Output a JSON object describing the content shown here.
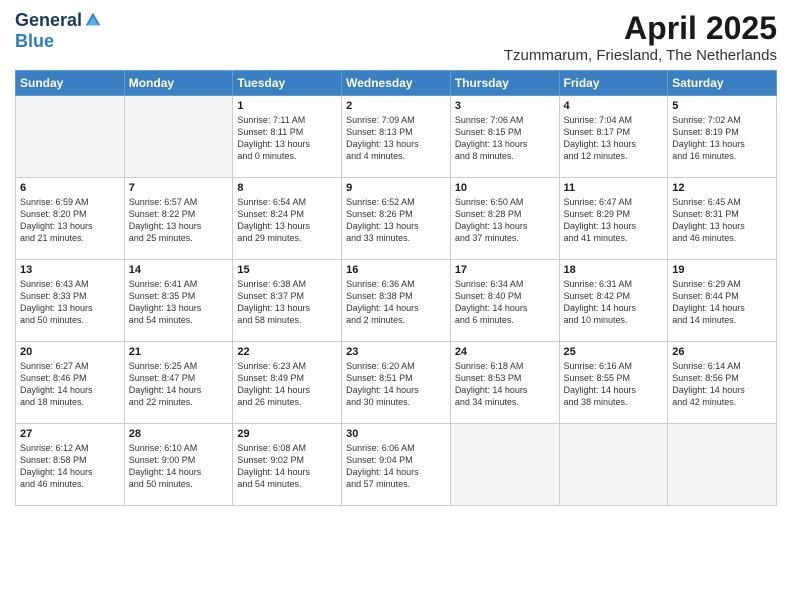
{
  "logo": {
    "general": "General",
    "blue": "Blue"
  },
  "title": "April 2025",
  "location": "Tzummarum, Friesland, The Netherlands",
  "weekdays": [
    "Sunday",
    "Monday",
    "Tuesday",
    "Wednesday",
    "Thursday",
    "Friday",
    "Saturday"
  ],
  "weeks": [
    [
      {
        "day": "",
        "info": ""
      },
      {
        "day": "",
        "info": ""
      },
      {
        "day": "1",
        "info": "Sunrise: 7:11 AM\nSunset: 8:11 PM\nDaylight: 13 hours\nand 0 minutes."
      },
      {
        "day": "2",
        "info": "Sunrise: 7:09 AM\nSunset: 8:13 PM\nDaylight: 13 hours\nand 4 minutes."
      },
      {
        "day": "3",
        "info": "Sunrise: 7:06 AM\nSunset: 8:15 PM\nDaylight: 13 hours\nand 8 minutes."
      },
      {
        "day": "4",
        "info": "Sunrise: 7:04 AM\nSunset: 8:17 PM\nDaylight: 13 hours\nand 12 minutes."
      },
      {
        "day": "5",
        "info": "Sunrise: 7:02 AM\nSunset: 8:19 PM\nDaylight: 13 hours\nand 16 minutes."
      }
    ],
    [
      {
        "day": "6",
        "info": "Sunrise: 6:59 AM\nSunset: 8:20 PM\nDaylight: 13 hours\nand 21 minutes."
      },
      {
        "day": "7",
        "info": "Sunrise: 6:57 AM\nSunset: 8:22 PM\nDaylight: 13 hours\nand 25 minutes."
      },
      {
        "day": "8",
        "info": "Sunrise: 6:54 AM\nSunset: 8:24 PM\nDaylight: 13 hours\nand 29 minutes."
      },
      {
        "day": "9",
        "info": "Sunrise: 6:52 AM\nSunset: 8:26 PM\nDaylight: 13 hours\nand 33 minutes."
      },
      {
        "day": "10",
        "info": "Sunrise: 6:50 AM\nSunset: 8:28 PM\nDaylight: 13 hours\nand 37 minutes."
      },
      {
        "day": "11",
        "info": "Sunrise: 6:47 AM\nSunset: 8:29 PM\nDaylight: 13 hours\nand 41 minutes."
      },
      {
        "day": "12",
        "info": "Sunrise: 6:45 AM\nSunset: 8:31 PM\nDaylight: 13 hours\nand 46 minutes."
      }
    ],
    [
      {
        "day": "13",
        "info": "Sunrise: 6:43 AM\nSunset: 8:33 PM\nDaylight: 13 hours\nand 50 minutes."
      },
      {
        "day": "14",
        "info": "Sunrise: 6:41 AM\nSunset: 8:35 PM\nDaylight: 13 hours\nand 54 minutes."
      },
      {
        "day": "15",
        "info": "Sunrise: 6:38 AM\nSunset: 8:37 PM\nDaylight: 13 hours\nand 58 minutes."
      },
      {
        "day": "16",
        "info": "Sunrise: 6:36 AM\nSunset: 8:38 PM\nDaylight: 14 hours\nand 2 minutes."
      },
      {
        "day": "17",
        "info": "Sunrise: 6:34 AM\nSunset: 8:40 PM\nDaylight: 14 hours\nand 6 minutes."
      },
      {
        "day": "18",
        "info": "Sunrise: 6:31 AM\nSunset: 8:42 PM\nDaylight: 14 hours\nand 10 minutes."
      },
      {
        "day": "19",
        "info": "Sunrise: 6:29 AM\nSunset: 8:44 PM\nDaylight: 14 hours\nand 14 minutes."
      }
    ],
    [
      {
        "day": "20",
        "info": "Sunrise: 6:27 AM\nSunset: 8:46 PM\nDaylight: 14 hours\nand 18 minutes."
      },
      {
        "day": "21",
        "info": "Sunrise: 6:25 AM\nSunset: 8:47 PM\nDaylight: 14 hours\nand 22 minutes."
      },
      {
        "day": "22",
        "info": "Sunrise: 6:23 AM\nSunset: 8:49 PM\nDaylight: 14 hours\nand 26 minutes."
      },
      {
        "day": "23",
        "info": "Sunrise: 6:20 AM\nSunset: 8:51 PM\nDaylight: 14 hours\nand 30 minutes."
      },
      {
        "day": "24",
        "info": "Sunrise: 6:18 AM\nSunset: 8:53 PM\nDaylight: 14 hours\nand 34 minutes."
      },
      {
        "day": "25",
        "info": "Sunrise: 6:16 AM\nSunset: 8:55 PM\nDaylight: 14 hours\nand 38 minutes."
      },
      {
        "day": "26",
        "info": "Sunrise: 6:14 AM\nSunset: 8:56 PM\nDaylight: 14 hours\nand 42 minutes."
      }
    ],
    [
      {
        "day": "27",
        "info": "Sunrise: 6:12 AM\nSunset: 8:58 PM\nDaylight: 14 hours\nand 46 minutes."
      },
      {
        "day": "28",
        "info": "Sunrise: 6:10 AM\nSunset: 9:00 PM\nDaylight: 14 hours\nand 50 minutes."
      },
      {
        "day": "29",
        "info": "Sunrise: 6:08 AM\nSunset: 9:02 PM\nDaylight: 14 hours\nand 54 minutes."
      },
      {
        "day": "30",
        "info": "Sunrise: 6:06 AM\nSunset: 9:04 PM\nDaylight: 14 hours\nand 57 minutes."
      },
      {
        "day": "",
        "info": ""
      },
      {
        "day": "",
        "info": ""
      },
      {
        "day": "",
        "info": ""
      }
    ]
  ]
}
